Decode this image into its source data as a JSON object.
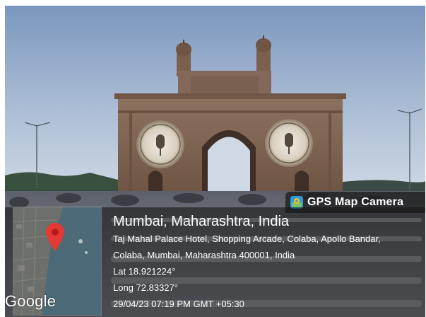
{
  "photo": {
    "subject": "Gateway of India",
    "colors": {
      "sky_top": "#7f9cc2",
      "sky_bottom": "#c9d6e6",
      "stone": "#8a6d58",
      "stone_dark": "#5e4636",
      "crowd": "#4a4d55",
      "chairs": "#c7ccd3"
    }
  },
  "overlay": {
    "app_badge": {
      "label": "GPS Map Camera",
      "icon": "map-pin-app-icon"
    },
    "map": {
      "pin_color": "#e53935",
      "logo_text": "Google"
    },
    "location": {
      "city_line": "Mumbai, Maharashtra, India",
      "address": "Taj Mahal Palace Hotel, Shopping Arcade, Colaba, Apollo Bandar, Colaba, Mumbai, Maharashtra 400001, India",
      "latitude": "Lat 18.921224°",
      "longitude": "Long 72.83327°",
      "timestamp": "29/04/23 07:19 PM GMT +05:30"
    }
  }
}
